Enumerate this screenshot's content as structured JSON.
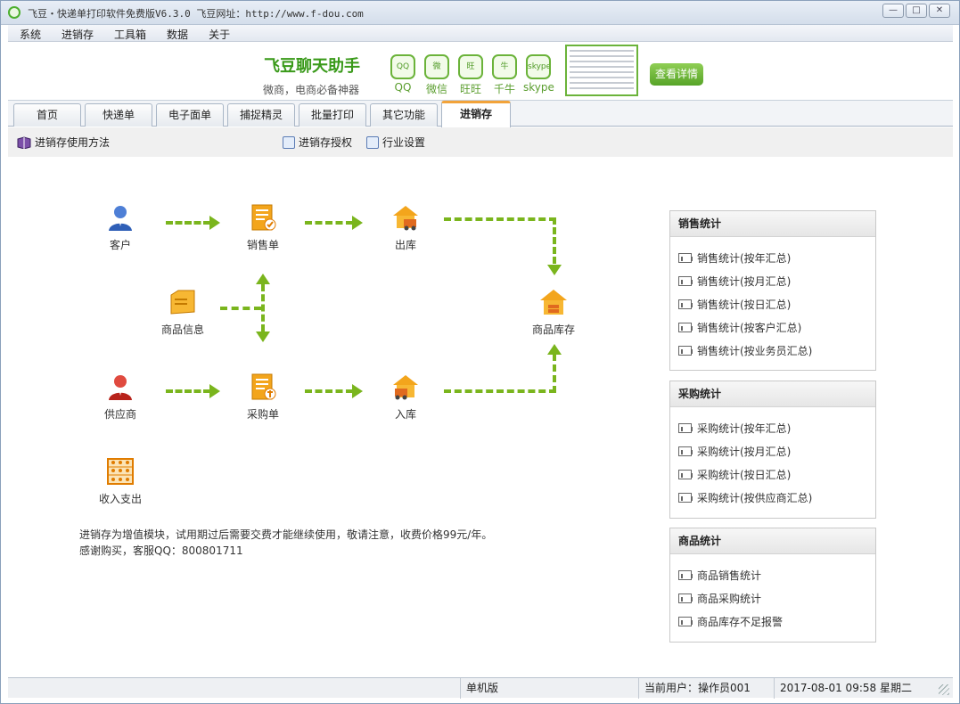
{
  "window": {
    "title": "飞豆・快递单打印软件免费版V6.3.0  飞豆网址：http://www.f-dou.com",
    "buttons": {
      "minimize": "—",
      "maximize": "□",
      "close": "✕"
    }
  },
  "menu": [
    "系统",
    "进销存",
    "工具箱",
    "数据",
    "关于"
  ],
  "banner": {
    "brand": "飞豆聊天助手",
    "slogan": "微商，电商必备神器",
    "apps": [
      {
        "label": "QQ",
        "icon": "qq-icon",
        "glyph": "QQ"
      },
      {
        "label": "微信",
        "icon": "wechat-icon",
        "glyph": "微"
      },
      {
        "label": "旺旺",
        "icon": "wangwang-icon",
        "glyph": "旺"
      },
      {
        "label": "千牛",
        "icon": "qianniu-icon",
        "glyph": "牛"
      },
      {
        "label": "skype",
        "icon": "skype-icon",
        "glyph": "skype"
      }
    ],
    "detail_button": "查看详情"
  },
  "tabs": [
    "首页",
    "快递单",
    "电子面单",
    "捕捉精灵",
    "批量打印",
    "其它功能",
    "进销存"
  ],
  "active_tab": "进销存",
  "toolbar": {
    "help": "进销存使用方法",
    "license": "进销存授权",
    "industry": "行业设置"
  },
  "flow": {
    "customer": "客户",
    "sales_order": "销售单",
    "outbound": "出库",
    "product_info": "商品信息",
    "stock": "商品库存",
    "supplier": "供应商",
    "purchase_order": "采购单",
    "inbound": "入库",
    "finance": "收入支出"
  },
  "notice": {
    "line1": "进销存为增值模块，试用期过后需要交费才能继续使用，敬请注意，收费价格99元/年。",
    "line2": "感谢购买，客服QQ：800801711"
  },
  "panels": {
    "sales": {
      "title": "销售统计",
      "items": [
        "销售统计(按年汇总)",
        "销售统计(按月汇总)",
        "销售统计(按日汇总)",
        "销售统计(按客户汇总)",
        "销售统计(按业务员汇总)"
      ]
    },
    "purchase": {
      "title": "采购统计",
      "items": [
        "采购统计(按年汇总)",
        "采购统计(按月汇总)",
        "采购统计(按日汇总)",
        "采购统计(按供应商汇总)"
      ]
    },
    "product": {
      "title": "商品统计",
      "items": [
        "商品销售统计",
        "商品采购统计",
        "商品库存不足报警"
      ]
    }
  },
  "status": {
    "edition": "单机版",
    "user": "当前用户：操作员001",
    "datetime": "2017-08-01 09:58 星期二"
  },
  "colors": {
    "accent_green": "#7ab51d",
    "brand_green": "#3a9a1a",
    "tab_highlight": "#f2a33a"
  }
}
